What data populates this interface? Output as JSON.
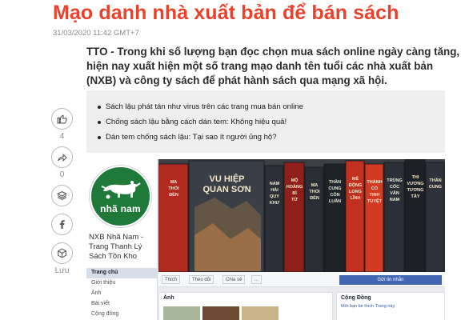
{
  "article": {
    "title": "Mạo danh nhà xuất bản để bán sách",
    "date": "31/03/2020 11:42 GMT+7",
    "sapo": "TTO - Trong khi số lượng bạn đọc chọn mua sách online ngày càng tăng, hiện nay xuất hiện một số trang mạo danh tên tuổi các nhà xuất bản (NXB) và công ty sách để phát hành sách qua mạng xã hội."
  },
  "social": {
    "like_count": "4",
    "share_count": "0",
    "save_label": "Lưu",
    "icons": [
      "thumbs-up-icon",
      "share-icon",
      "layers-icon",
      "facebook-icon",
      "box-icon"
    ]
  },
  "related": {
    "items": [
      "Sách lậu phát tán như virus trên các trang mua bán online",
      "Chống sách lậu bằng cách dán tem: Không hiệu quả!",
      "Dán tem chống sách lậu: Tại sao ít người ủng hộ?"
    ]
  },
  "photo": {
    "logo_text": "nhã nam",
    "page_name": "NXB Nhã Nam - Trang Thanh Lý Sách Tồn Kho",
    "menu": [
      "Trang chủ",
      "Giới thiệu",
      "Ảnh",
      "Bài viết",
      "Cộng đồng"
    ],
    "buttons": {
      "like": "Thích",
      "follow": "Theo dõi",
      "share": "Chia sẻ",
      "more": "...",
      "send": "Gửi tin nhắn"
    },
    "panel_photos": "Ảnh",
    "panel_community": "Cộng Đồng",
    "panel_community_sub": "Mời bạn bè thích Trang này",
    "books": [
      {
        "title": "MA THỔI ĐÈN",
        "color": "#b22a1f"
      },
      {
        "title": "VU HIỆP QUAN SƠN",
        "color": "#3a3f47"
      },
      {
        "title": "NAM HẢI QUY KHƯ",
        "color": "#2c2f36"
      },
      {
        "title": "MỘ HOÀNG BÌ TỬ",
        "color": "#8f1f1a"
      },
      {
        "title": "MA THỔI ĐÈN",
        "color": "#2a2d33"
      },
      {
        "title": "THẦN CUNG CÔN LUÂN",
        "color": "#1f2228"
      },
      {
        "title": "MÊ ĐỘNG LONG LĨNH",
        "color": "#c2311f"
      },
      {
        "title": "THÀNH CỔ TINH TUYỆT",
        "color": "#d23a22"
      },
      {
        "title": "TRÙNG CỐC VÂN NAM",
        "color": "#2b3038"
      },
      {
        "title": "THI VƯƠNG TƯƠNG TÂY",
        "color": "#1d2026"
      },
      {
        "title": "THẦN CUNG",
        "color": "#2e3139"
      }
    ]
  }
}
